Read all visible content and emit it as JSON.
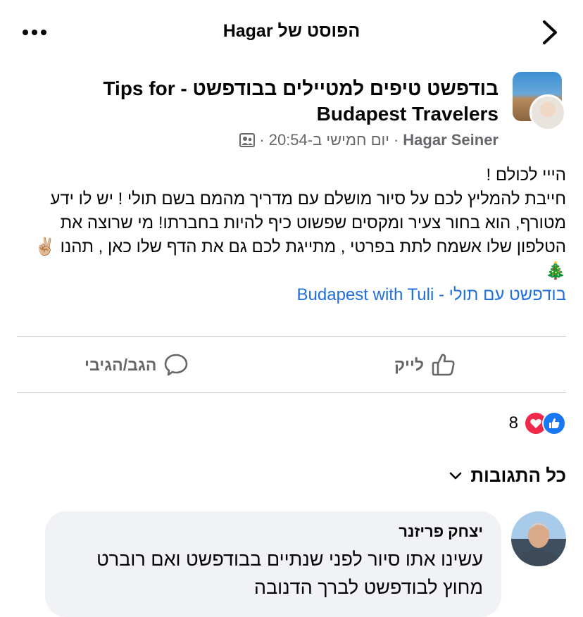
{
  "header": {
    "title": "הפוסט של Hagar",
    "more_icon": "more-icon",
    "back_icon": "chevron-right-icon"
  },
  "post": {
    "group_name": "בודפשט טיפים למטיילים בבודפשט - Tips for Budapest Travelers",
    "author": "Hagar Seiner",
    "time": "יום חמישי ב-20:54",
    "separator": "·",
    "privacy_icon": "group-members-icon",
    "body_lines": [
      "הייי לכולם !",
      "חייבת להמליץ לכם על סיור מושלם עם מדריך מהמם בשם תולי ! יש לו ידע מטורף, הוא בחור צעיר ומקסים שפשוט כיף להיות בחברתו! מי שרוצה את הטלפון שלו אשמח לתת בפרטי , מתייגת לכם גם את הדף שלו כאן , תהנו ✌🏼🎄"
    ],
    "link_text": "בודפשט עם תולי - Budapest with Tuli",
    "link_color": "#216fdb"
  },
  "actions": {
    "like_label": "לייק",
    "comment_label": "הגב/הגיבי"
  },
  "reactions": {
    "count": "8",
    "types": [
      "like",
      "love"
    ],
    "like_color": "#1877f2",
    "love_color": "#f02849"
  },
  "comments": {
    "filter_label": "כל התגובות",
    "items": [
      {
        "author": "יצחק פריזנר",
        "text": "עשינו אתו סיור לפני שנתיים בבודפשט ואם רוברט מחוץ לבודפשט לברך הדנובה"
      }
    ]
  }
}
